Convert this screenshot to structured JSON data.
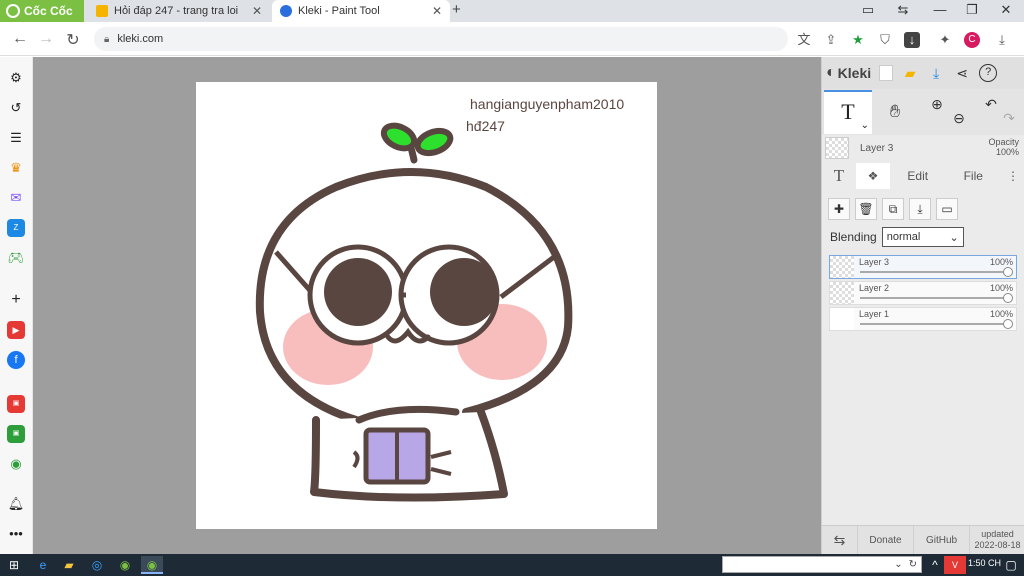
{
  "browser": {
    "brand": "Cốc Cốc",
    "tabs": [
      {
        "title": "Hỏi đáp 247 - trang tra loi",
        "icon": "hoidap-favicon"
      },
      {
        "title": "Kleki - Paint Tool",
        "icon": "kleki-favicon",
        "active": true
      }
    ],
    "new_tab_label": "+",
    "url": "kleki.com"
  },
  "canvas": {
    "watermark_line1": "hangianguyenpham2010",
    "watermark_line2": "hđ247"
  },
  "kleki": {
    "logo": "Kleki",
    "current_tool_glyph": "T",
    "current_layer": {
      "name": "Layer 3",
      "opacity_label": "Opacity",
      "opacity_value": "100%"
    },
    "tabs": [
      "Edit",
      "File"
    ],
    "blending_label": "Blending",
    "blending_value": "normal",
    "layers": [
      {
        "name": "Layer 3",
        "opacity": "100%",
        "selected": true
      },
      {
        "name": "Layer 2",
        "opacity": "100%",
        "selected": false
      },
      {
        "name": "Layer 1",
        "opacity": "100%",
        "selected": false
      }
    ],
    "footer": {
      "donate": "Donate",
      "github": "GitHub",
      "updated_label": "updated",
      "updated_date": "2022-08-18"
    }
  },
  "taskbar": {
    "time": "1:50 CH"
  },
  "colors": {
    "brand_green": "#7bc043",
    "accent_blue": "#4a90e2",
    "doodle_brown": "#5a4641",
    "blush_pink": "#f7b7b7",
    "sprout_green": "#2ee02e",
    "book_purple": "#b7a7e6"
  }
}
